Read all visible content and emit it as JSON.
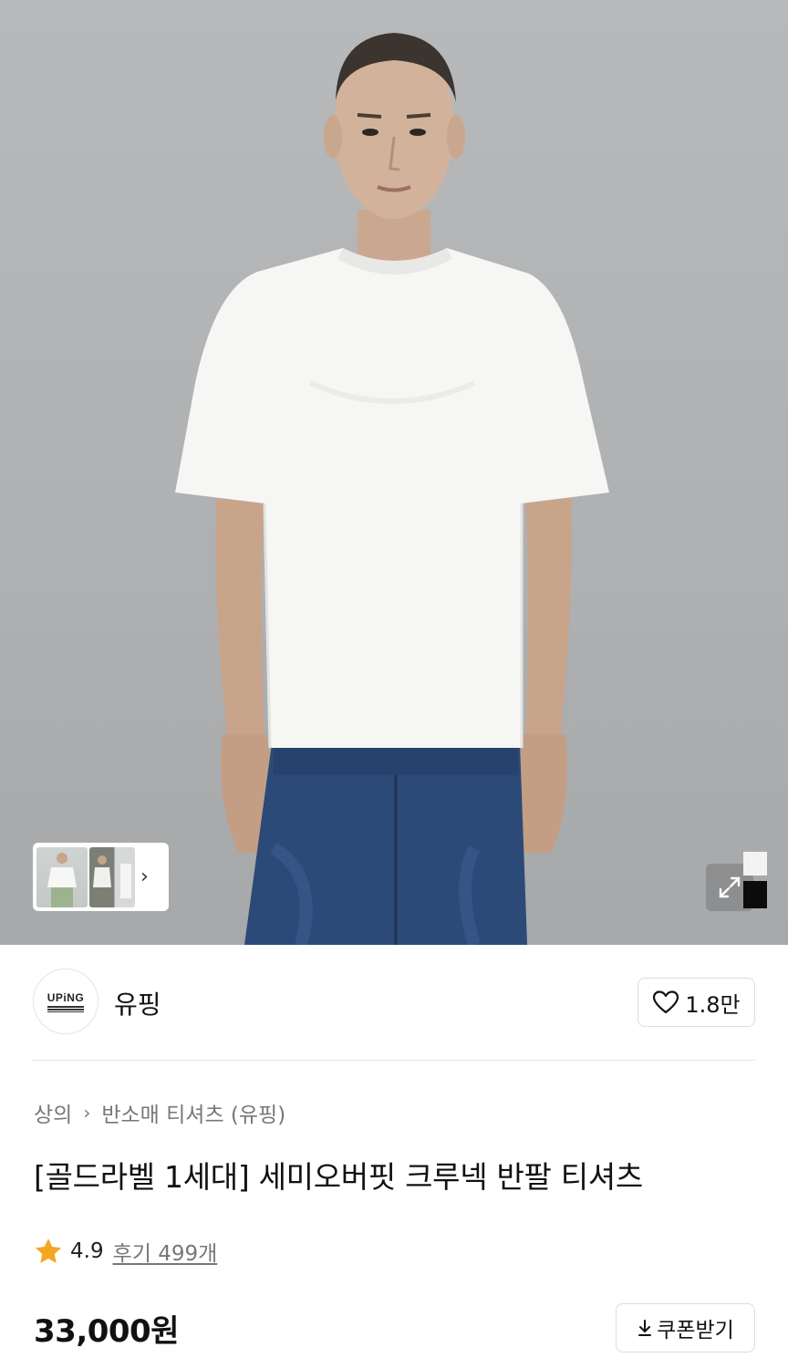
{
  "brand": {
    "logo_text": "UPiNG",
    "name": "유핑",
    "like_count": "1.8만"
  },
  "gallery": {
    "thumbnail_count": 2
  },
  "breadcrumb": {
    "category": "상의",
    "subcategory": "반소매 티셔츠 (유핑)"
  },
  "product": {
    "title": "[골드라벨 1세대] 세미오버핏 크루넥 반팔 티셔츠",
    "rating": "4.9",
    "reviews_label": "후기 499개",
    "price": "33,000원",
    "coupon_label": "쿠폰받기"
  },
  "colors": {
    "star": "#f5a623",
    "text_primary": "#111111",
    "text_secondary": "#777777",
    "border": "#dcdcdc"
  },
  "icons": [
    "heart-icon",
    "chevron-right-icon",
    "expand-icon",
    "star-icon",
    "download-icon"
  ]
}
